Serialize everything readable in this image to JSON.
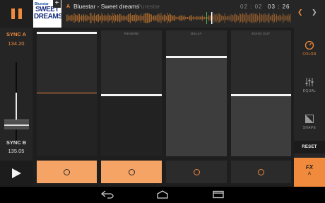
{
  "deck": {
    "badge": "A",
    "title": "Bluestar - Sweet dreams",
    "artist": "Purestar",
    "time_elapsed": "02 : 02",
    "time_remaining": "03 : 26",
    "add_label": "+",
    "cover": {
      "line1": "Bluestar",
      "line2": "SWEET",
      "line3": "DREAMS",
      "line4": ""
    }
  },
  "left": {
    "sync_a": "SYNC A",
    "bpm_a": "134.20",
    "sync_b": "SYNC B",
    "bpm_b": "135.05"
  },
  "fx_panels": [
    {
      "label": "",
      "level": 0.5,
      "button_on": true
    },
    {
      "label": "REVERB",
      "level": 0.49,
      "button_on": true
    },
    {
      "label": "DELAY",
      "level": 0.79,
      "button_on": false
    },
    {
      "label": "ECHO OUT",
      "level": 0.49,
      "button_on": false
    }
  ],
  "right": {
    "color_label": "COLOR",
    "equal_label": "EQUAL",
    "shape_label": "SHAPE",
    "reset_label": "RESET",
    "fx_label": "FX",
    "fx_deck": "A"
  },
  "colors": {
    "accent": "#f08a3c",
    "accent_light": "#f5a466",
    "background": "#1b1b1b",
    "panel": "#2b2b2b"
  },
  "icons": {
    "pause": "pause-icon",
    "play": "play-icon",
    "color": "gauge-icon",
    "equal": "equalizer-icon",
    "shape": "shape-icon",
    "back": "back-arrow-icon",
    "home": "home-icon",
    "recents": "recents-icon"
  }
}
